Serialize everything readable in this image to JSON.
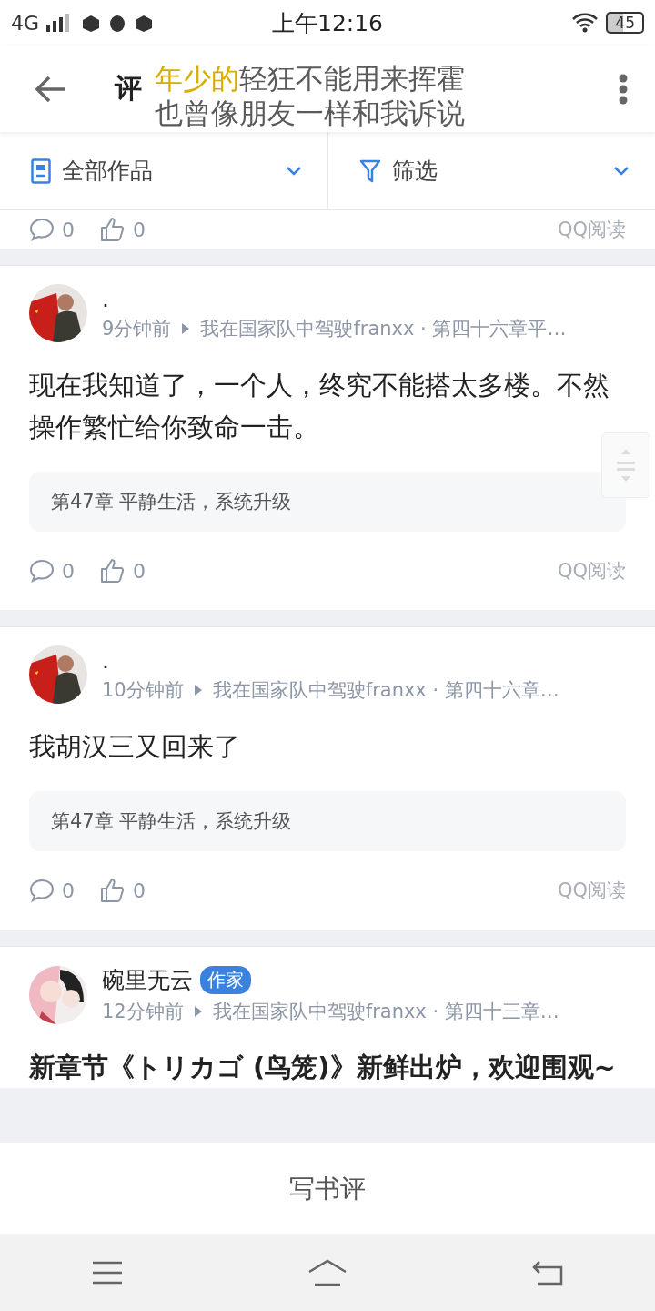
{
  "status_bar": {
    "network": "4G",
    "time": "上午12:16",
    "battery": "45"
  },
  "header": {
    "title": "评"
  },
  "lyrics_overlay": [
    {
      "sung": "年少的",
      "rest": "轻狂不能用来挥霍"
    },
    {
      "rest": "也曾像朋友一样和我诉说"
    }
  ],
  "filters": [
    {
      "label": "全部作品",
      "kind": "works"
    },
    {
      "label": "筛选",
      "kind": "filter"
    }
  ],
  "partial_footer": {
    "comments": "0",
    "likes": "0",
    "source": "QQ阅读"
  },
  "posts": [
    {
      "kind": "comment",
      "name": ".",
      "time": "9分钟前",
      "book": "我在国家队中驾驶franxx · 第四十六章平…",
      "text": "现在我知道了，一个人，终究不能搭太多楼。不然操作繁忙给你致命一击。",
      "quote": "第47章 平静生活，系统升级",
      "comments": "0",
      "likes": "0",
      "source": "QQ阅读"
    },
    {
      "kind": "comment",
      "name": ".",
      "time": "10分钟前",
      "book": "我在国家队中驾驶franxx · 第四十六章…",
      "text": "我胡汉三又回来了",
      "quote": "第47章 平静生活，系统升级",
      "comments": "0",
      "likes": "0",
      "source": "QQ阅读"
    },
    {
      "kind": "announcement",
      "name": "碗里无云",
      "badge": "作家",
      "time": "12分钟前",
      "book": "我在国家队中驾驶franxx · 第四十三章…",
      "text": "新章节《トリカゴ (鸟笼)》新鲜出炉，欢迎围观~"
    }
  ],
  "write_button": "写书评"
}
